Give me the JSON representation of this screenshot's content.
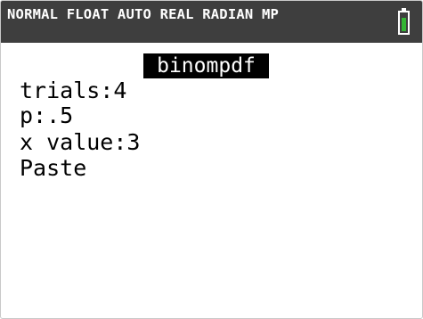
{
  "status_bar": {
    "text": "NORMAL FLOAT AUTO REAL RADIAN MP",
    "battery_icon": "battery-icon",
    "battery_level": 0.8,
    "battery_color": "#33b533"
  },
  "screen": {
    "title": "binompdf",
    "fields": [
      {
        "label": "trials:",
        "value": "4"
      },
      {
        "label": "p:",
        "value": ".5"
      },
      {
        "label": "x value:",
        "value": "3"
      }
    ],
    "paste_label": "Paste"
  }
}
